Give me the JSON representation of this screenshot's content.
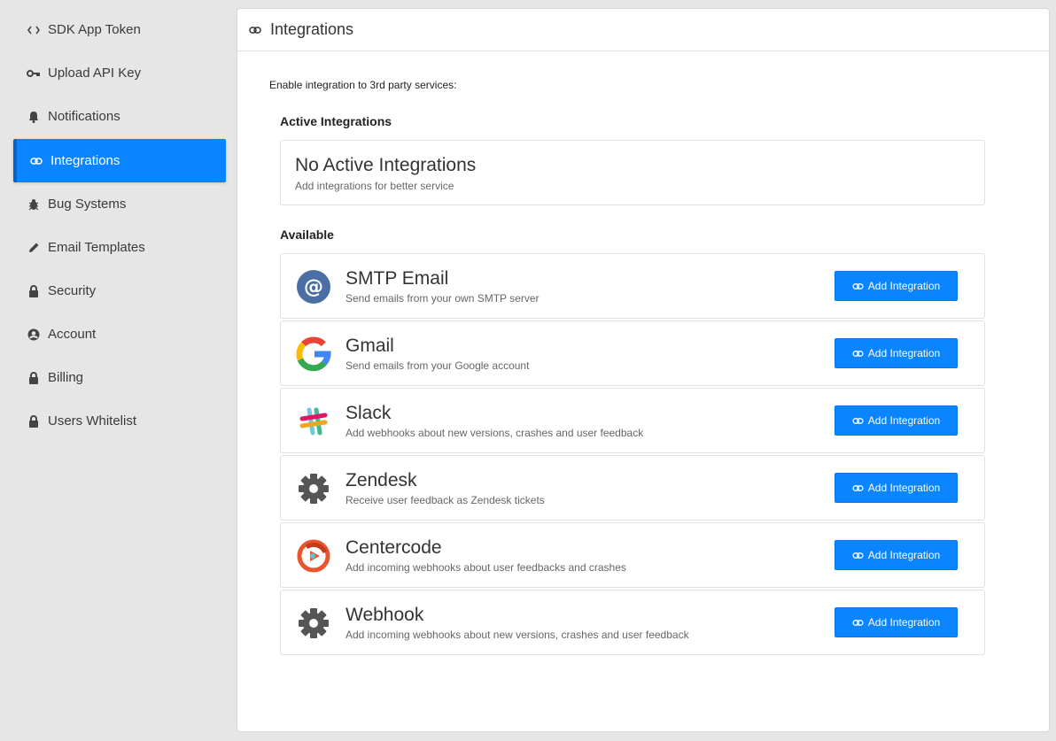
{
  "sidebar": {
    "items": [
      {
        "label": "SDK App Token",
        "icon": "code-icon"
      },
      {
        "label": "Upload API Key",
        "icon": "key-icon"
      },
      {
        "label": "Notifications",
        "icon": "bell-icon"
      },
      {
        "label": "Integrations",
        "icon": "link-icon",
        "active": true
      },
      {
        "label": "Bug Systems",
        "icon": "bug-icon"
      },
      {
        "label": "Email Templates",
        "icon": "pencil-icon"
      },
      {
        "label": "Security",
        "icon": "lock-icon"
      },
      {
        "label": "Account",
        "icon": "user-circle-icon"
      },
      {
        "label": "Billing",
        "icon": "lock-icon"
      },
      {
        "label": "Users Whitelist",
        "icon": "lock-icon"
      }
    ]
  },
  "header": {
    "title": "Integrations"
  },
  "intro": "Enable integration to 3rd party services:",
  "active_section": {
    "title": "Active Integrations",
    "empty_title": "No Active Integrations",
    "empty_subtitle": "Add integrations for better service"
  },
  "available_section": {
    "title": "Available",
    "button_label": "Add Integration",
    "items": [
      {
        "name": "SMTP Email",
        "description": "Send emails from your own SMTP server",
        "icon": "smtp-at-icon"
      },
      {
        "name": "Gmail",
        "description": "Send emails from your Google account",
        "icon": "google-icon"
      },
      {
        "name": "Slack",
        "description": "Add webhooks about new versions, crashes and user feedback",
        "icon": "slack-icon"
      },
      {
        "name": "Zendesk",
        "description": "Receive user feedback as Zendesk tickets",
        "icon": "gear-icon"
      },
      {
        "name": "Centercode",
        "description": "Add incoming webhooks about user feedbacks and crashes",
        "icon": "centercode-icon"
      },
      {
        "name": "Webhook",
        "description": "Add incoming webhooks about new versions, crashes and user feedback",
        "icon": "gear-icon"
      }
    ]
  },
  "colors": {
    "accent": "#0a84ff",
    "background": "#e6e6e6"
  }
}
